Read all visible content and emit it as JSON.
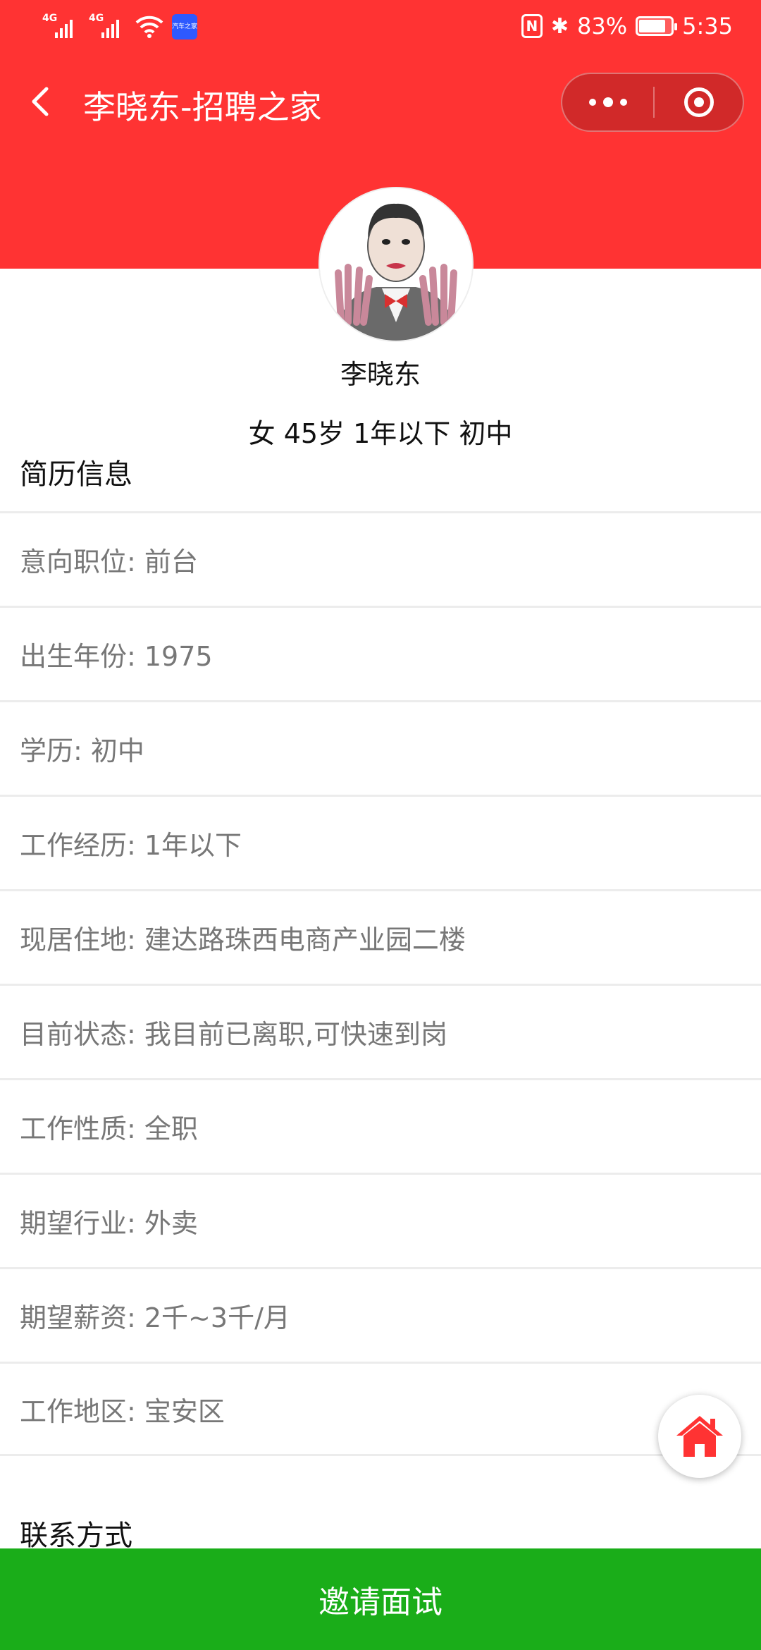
{
  "status_bar": {
    "signal1_label": "4G",
    "signal2_label": "4G",
    "app_badge": "汽车之家",
    "battery_percent": "83%",
    "battery_level": 0.83,
    "time": "5:35"
  },
  "nav": {
    "title": "李晓东-招聘之家"
  },
  "profile": {
    "name": "李晓东",
    "meta": "女 45岁 1年以下 初中"
  },
  "sections": {
    "resume_title": "简历信息",
    "contact_title": "联系方式"
  },
  "resume_items": [
    "意向职位: 前台",
    "出生年份: 1975",
    "学历: 初中",
    "工作经历: 1年以下",
    "现居住地: 建达路珠西电商产业园二楼",
    "目前状态: 我目前已离职,可快速到岗",
    "工作性质: 全职",
    "期望行业: 外卖",
    "期望薪资: 2千~3千/月",
    "工作地区: 宝安区"
  ],
  "actions": {
    "invite_label": "邀请面试"
  },
  "colors": {
    "header": "#ff3333",
    "primary_button": "#1aad19",
    "home_icon": "#ff3333"
  }
}
